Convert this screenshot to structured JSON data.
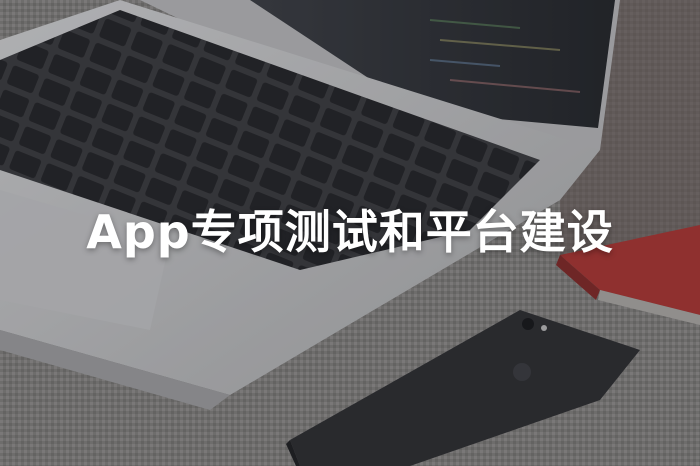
{
  "banner": {
    "headline": "App专项测试和平台建设"
  },
  "colors": {
    "fabric": "#8c8a88",
    "laptop_body": "#cfd0d2",
    "keys": "#2b2c30",
    "phone": "#2a2b2f",
    "red_object": "#c0302f",
    "text": "#ffffff"
  }
}
